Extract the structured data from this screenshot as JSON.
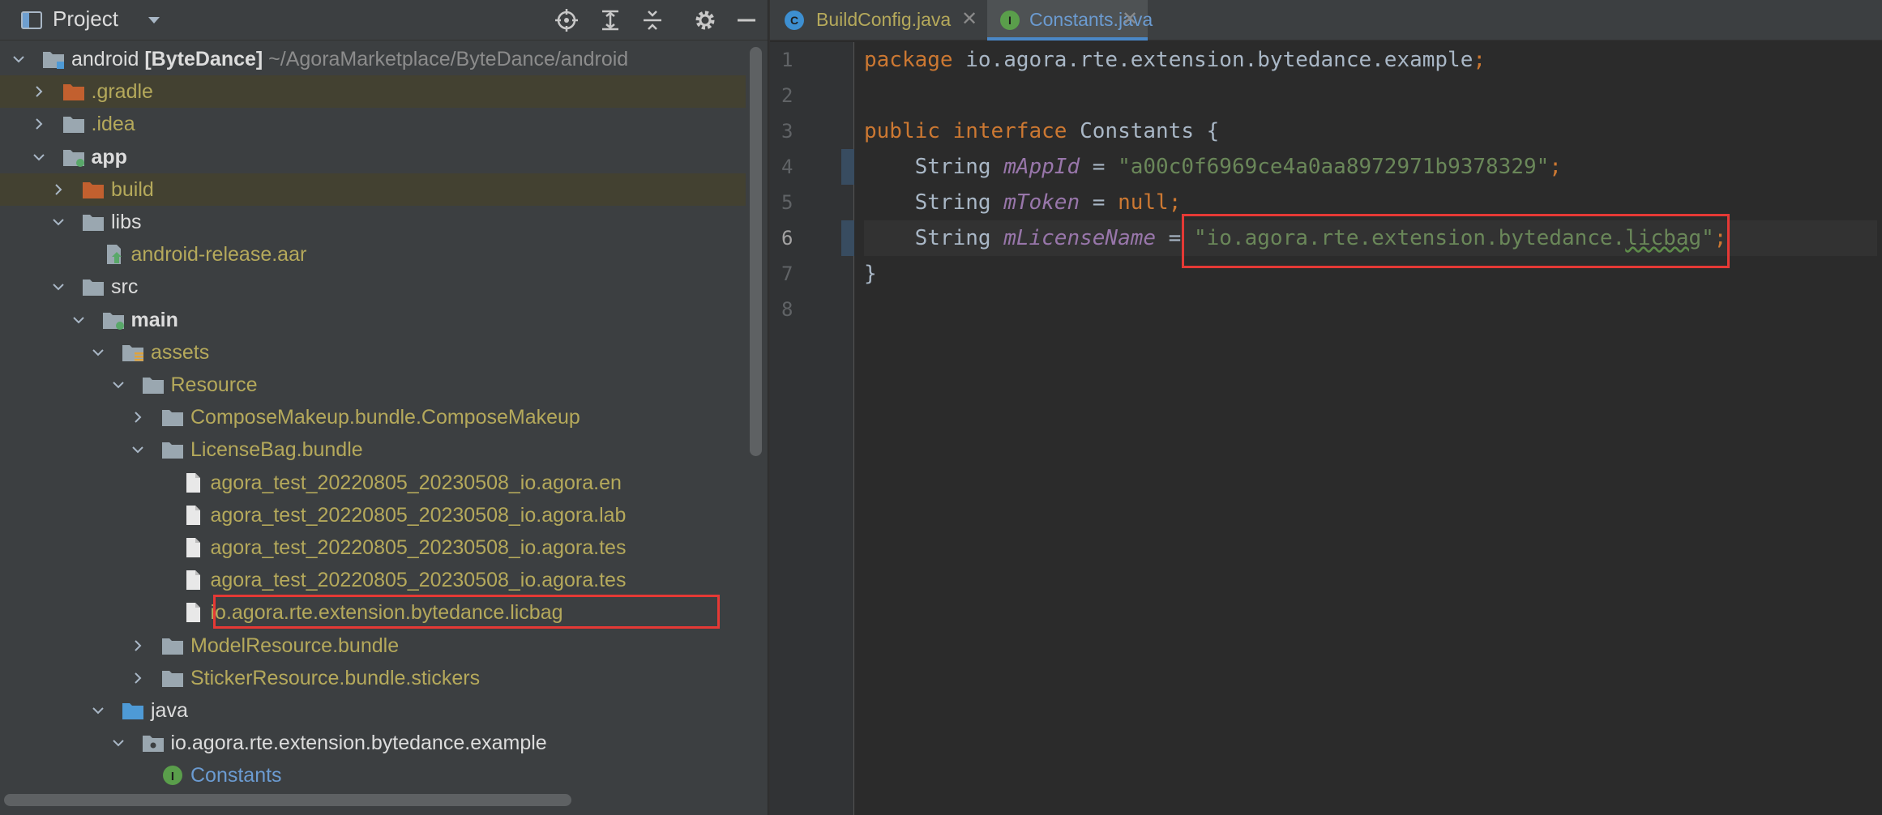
{
  "project_panel": {
    "title": "Project",
    "tree": [
      {
        "indent": 0,
        "arrow": "down",
        "icon": "module",
        "label": "android",
        "module_tag": "[ByteDance]",
        "path_text": " ~/AgoraMarketplace/ByteDance/android",
        "color": "white",
        "highlight": false
      },
      {
        "indent": 1,
        "arrow": "right",
        "icon": "folder-orange",
        "label": ".gradle",
        "color": "yellow",
        "highlight": true
      },
      {
        "indent": 1,
        "arrow": "right",
        "icon": "folder",
        "label": ".idea",
        "color": "yellow",
        "highlight": false
      },
      {
        "indent": 1,
        "arrow": "down",
        "icon": "module-dot",
        "label": "app",
        "color": "white",
        "bold": true,
        "highlight": false
      },
      {
        "indent": 2,
        "arrow": "right",
        "icon": "folder-orange",
        "label": "build",
        "color": "yellow",
        "highlight": true
      },
      {
        "indent": 2,
        "arrow": "down",
        "icon": "folder",
        "label": "libs",
        "color": "white",
        "highlight": false
      },
      {
        "indent": 3,
        "arrow": "none",
        "icon": "archive",
        "label": "android-release.aar",
        "color": "yellow",
        "highlight": false
      },
      {
        "indent": 2,
        "arrow": "down",
        "icon": "folder",
        "label": "src",
        "color": "white",
        "highlight": false
      },
      {
        "indent": 3,
        "arrow": "down",
        "icon": "module-dot",
        "label": "main",
        "color": "white",
        "bold": true,
        "highlight": false
      },
      {
        "indent": 4,
        "arrow": "down",
        "icon": "assets-folder",
        "label": "assets",
        "color": "yellow",
        "highlight": false
      },
      {
        "indent": 5,
        "arrow": "down",
        "icon": "folder",
        "label": "Resource",
        "color": "yellow",
        "highlight": false
      },
      {
        "indent": 6,
        "arrow": "right",
        "icon": "folder",
        "label": "ComposeMakeup.bundle.ComposeMakeup",
        "color": "yellow",
        "highlight": false
      },
      {
        "indent": 6,
        "arrow": "down",
        "icon": "folder",
        "label": "LicenseBag.bundle",
        "color": "yellow",
        "highlight": false
      },
      {
        "indent": 7,
        "arrow": "none",
        "icon": "file",
        "label": "agora_test_20220805_20230508_io.agora.en",
        "color": "yellow",
        "highlight": false
      },
      {
        "indent": 7,
        "arrow": "none",
        "icon": "file",
        "label": "agora_test_20220805_20230508_io.agora.lab",
        "color": "yellow",
        "highlight": false
      },
      {
        "indent": 7,
        "arrow": "none",
        "icon": "file",
        "label": "agora_test_20220805_20230508_io.agora.tes",
        "color": "yellow",
        "highlight": false
      },
      {
        "indent": 7,
        "arrow": "none",
        "icon": "file",
        "label": "agora_test_20220805_20230508_io.agora.tes",
        "color": "yellow",
        "highlight": false
      },
      {
        "indent": 7,
        "arrow": "none",
        "icon": "file",
        "label": "io.agora.rte.extension.bytedance.licbag",
        "color": "yellow",
        "highlight": false
      },
      {
        "indent": 6,
        "arrow": "right",
        "icon": "folder",
        "label": "ModelResource.bundle",
        "color": "yellow",
        "highlight": false
      },
      {
        "indent": 6,
        "arrow": "right",
        "icon": "folder",
        "label": "StickerResource.bundle.stickers",
        "color": "yellow",
        "highlight": false
      },
      {
        "indent": 4,
        "arrow": "down",
        "icon": "folder-blue",
        "label": "java",
        "color": "white",
        "highlight": false
      },
      {
        "indent": 5,
        "arrow": "down",
        "icon": "package",
        "label": "io.agora.rte.extension.bytedance.example",
        "color": "white",
        "highlight": false
      },
      {
        "indent": 6,
        "arrow": "none",
        "icon": "interface-badge",
        "label": "Constants",
        "color": "blue",
        "highlight": false
      }
    ]
  },
  "editor": {
    "tabs": [
      {
        "label": "BuildConfig.java",
        "badge": "C",
        "badge_color": "#3d8fd1",
        "active": false
      },
      {
        "label": "Constants.java",
        "badge": "I",
        "badge_color": "#5a9e4b",
        "active": true
      }
    ],
    "line_numbers": [
      "1",
      "2",
      "3",
      "4",
      "5",
      "6",
      "7",
      "8"
    ],
    "code_lines": [
      [
        {
          "t": "package ",
          "c": "kw"
        },
        {
          "t": "io.agora.rte.extension.bytedance.example",
          "c": "plain"
        },
        {
          "t": ";",
          "c": "kw"
        }
      ],
      [],
      [
        {
          "t": "public interface ",
          "c": "kw"
        },
        {
          "t": "Constants {",
          "c": "plain"
        }
      ],
      [
        {
          "t": "    String ",
          "c": "plain"
        },
        {
          "t": "mAppId",
          "c": "fld"
        },
        {
          "t": " = ",
          "c": "plain"
        },
        {
          "t": "\"a00c0f6969ce4a0aa8972971b9378329\"",
          "c": "str"
        },
        {
          "t": ";",
          "c": "kw"
        }
      ],
      [
        {
          "t": "    String ",
          "c": "plain"
        },
        {
          "t": "mToken",
          "c": "fld"
        },
        {
          "t": " = ",
          "c": "plain"
        },
        {
          "t": "null",
          "c": "kw"
        },
        {
          "t": ";",
          "c": "kw"
        }
      ],
      [
        {
          "t": "    String ",
          "c": "plain"
        },
        {
          "t": "mLicenseName",
          "c": "fld"
        },
        {
          "t": " = ",
          "c": "plain"
        },
        {
          "t": "\"io.agora.rte.extension.bytedance.",
          "c": "str"
        },
        {
          "t": "licbag",
          "c": "str squig"
        },
        {
          "t": "\"",
          "c": "str"
        },
        {
          "t": ";",
          "c": "kw"
        }
      ],
      [
        {
          "t": "}",
          "c": "plain"
        }
      ],
      []
    ],
    "current_line": 6
  },
  "colors": {
    "panel_bg": "#3c3f41",
    "editor_bg": "#2b2b2b",
    "keyword": "#cc7832",
    "string": "#6a8759",
    "field": "#9876aa",
    "annotation_red": "#e53935"
  }
}
